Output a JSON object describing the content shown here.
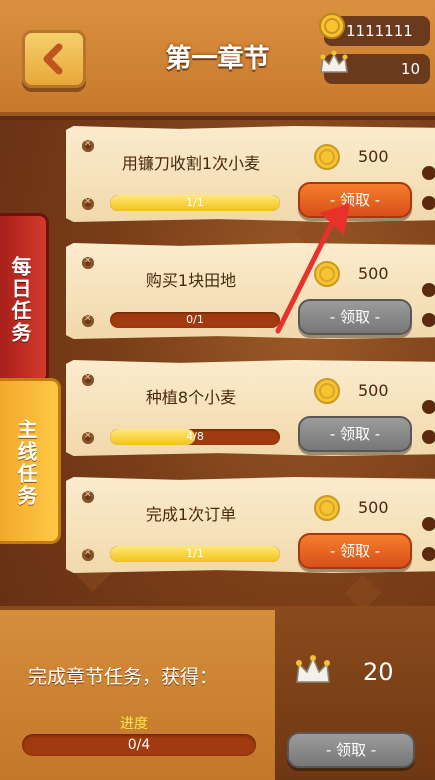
{
  "header": {
    "title": "第一章节",
    "coins": "1111111",
    "crowns": "10"
  },
  "tabs": {
    "daily": "每日任务",
    "main": "主线任务"
  },
  "tasks": [
    {
      "name": "用镰刀收割1次小麦",
      "reward": "500",
      "progress_text": "1/1",
      "progress": 1.0,
      "claim_label": "- 领取 -",
      "state": "active"
    },
    {
      "name": "购买1块田地",
      "reward": "500",
      "progress_text": "0/1",
      "progress": 0.0,
      "claim_label": "- 领取 -",
      "state": "inactive"
    },
    {
      "name": "种植8个小麦",
      "reward": "500",
      "progress_text": "4/8",
      "progress": 0.5,
      "claim_label": "- 领取 -",
      "state": "inactive"
    },
    {
      "name": "完成1次订单",
      "reward": "500",
      "progress_text": "1/1",
      "progress": 1.0,
      "claim_label": "- 领取 -",
      "state": "active"
    }
  ],
  "chapter": {
    "complete_text": "完成章节任务，获得：",
    "progress_label": "进度",
    "progress_text": "0/4",
    "progress": 0.0,
    "reward": "20",
    "claim_label": "- 领取 -"
  },
  "colors": {
    "claim_active": "#e0611f",
    "claim_inactive": "#8a8a8a",
    "progress_fill": "#f5cc24",
    "progress_track": "#a13a0e"
  }
}
